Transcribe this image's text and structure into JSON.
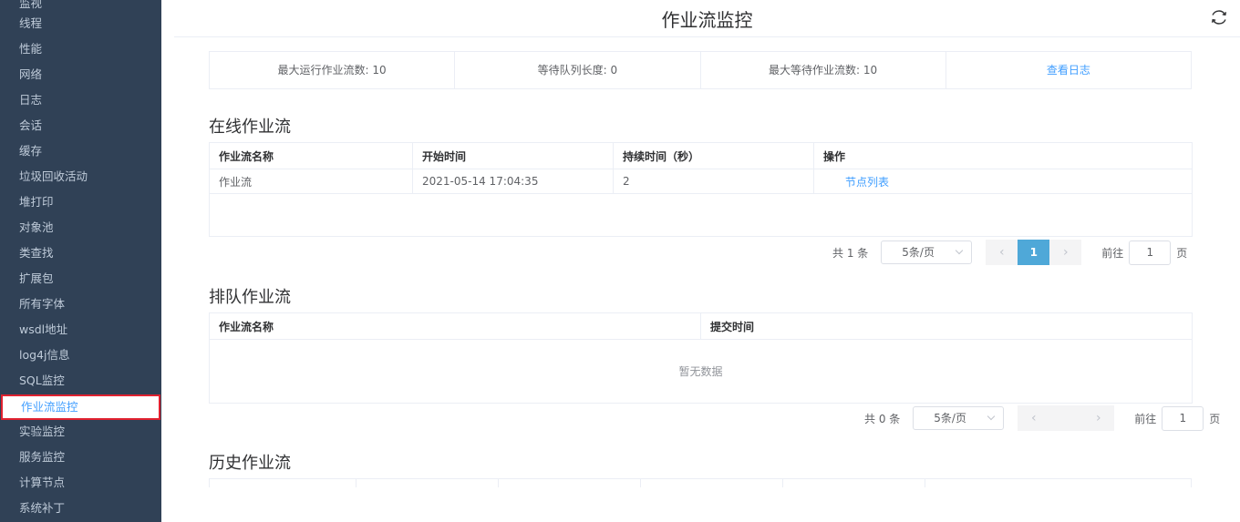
{
  "sidebar": {
    "items": [
      {
        "label": "监视"
      },
      {
        "label": "线程"
      },
      {
        "label": "性能"
      },
      {
        "label": "网络"
      },
      {
        "label": "日志"
      },
      {
        "label": "会话"
      },
      {
        "label": "缓存"
      },
      {
        "label": "垃圾回收活动"
      },
      {
        "label": "堆打印"
      },
      {
        "label": "对象池"
      },
      {
        "label": "类查找"
      },
      {
        "label": "扩展包"
      },
      {
        "label": "所有字体"
      },
      {
        "label": "wsdl地址"
      },
      {
        "label": "log4j信息"
      },
      {
        "label": "SQL监控"
      },
      {
        "label": "作业流监控"
      },
      {
        "label": "实验监控"
      },
      {
        "label": "服务监控"
      },
      {
        "label": "计算节点"
      },
      {
        "label": "系统补丁"
      }
    ]
  },
  "page": {
    "title": "作业流监控"
  },
  "stats": {
    "max_running": "最大运行作业流数: 10",
    "queue_length": "等待队列长度: 0",
    "max_waiting": "最大等待作业流数: 10",
    "view_log": "查看日志"
  },
  "online": {
    "title": "在线作业流",
    "headers": [
      "作业流名称",
      "开始时间",
      "持续时间（秒）",
      "操作"
    ],
    "rows": [
      {
        "name": "作业流",
        "start": "2021-05-14 17:04:35",
        "duration": "2",
        "action": "节点列表"
      }
    ],
    "pager": {
      "total": "共 1 条",
      "page_size": "5条/页",
      "current": "1",
      "goto": "前往",
      "page_input": "1",
      "page_unit": "页"
    }
  },
  "queued": {
    "title": "排队作业流",
    "headers": [
      "作业流名称",
      "提交时间"
    ],
    "empty_text": "暂无数据",
    "pager": {
      "total": "共 0 条",
      "page_size": "5条/页",
      "goto": "前往",
      "page_input": "1",
      "page_unit": "页"
    }
  },
  "history": {
    "title": "历史作业流"
  },
  "icons": {
    "refresh": "refresh-icon",
    "prev": "chevron-left-icon",
    "next": "chevron-right-icon",
    "dropdown": "chevron-down-icon"
  },
  "colors": {
    "sidebar_bg": "#304156",
    "sidebar_text": "#bfcbd9",
    "accent": "#409eff",
    "active_outline": "#e0212f",
    "pager_active": "#4fa8d8"
  }
}
